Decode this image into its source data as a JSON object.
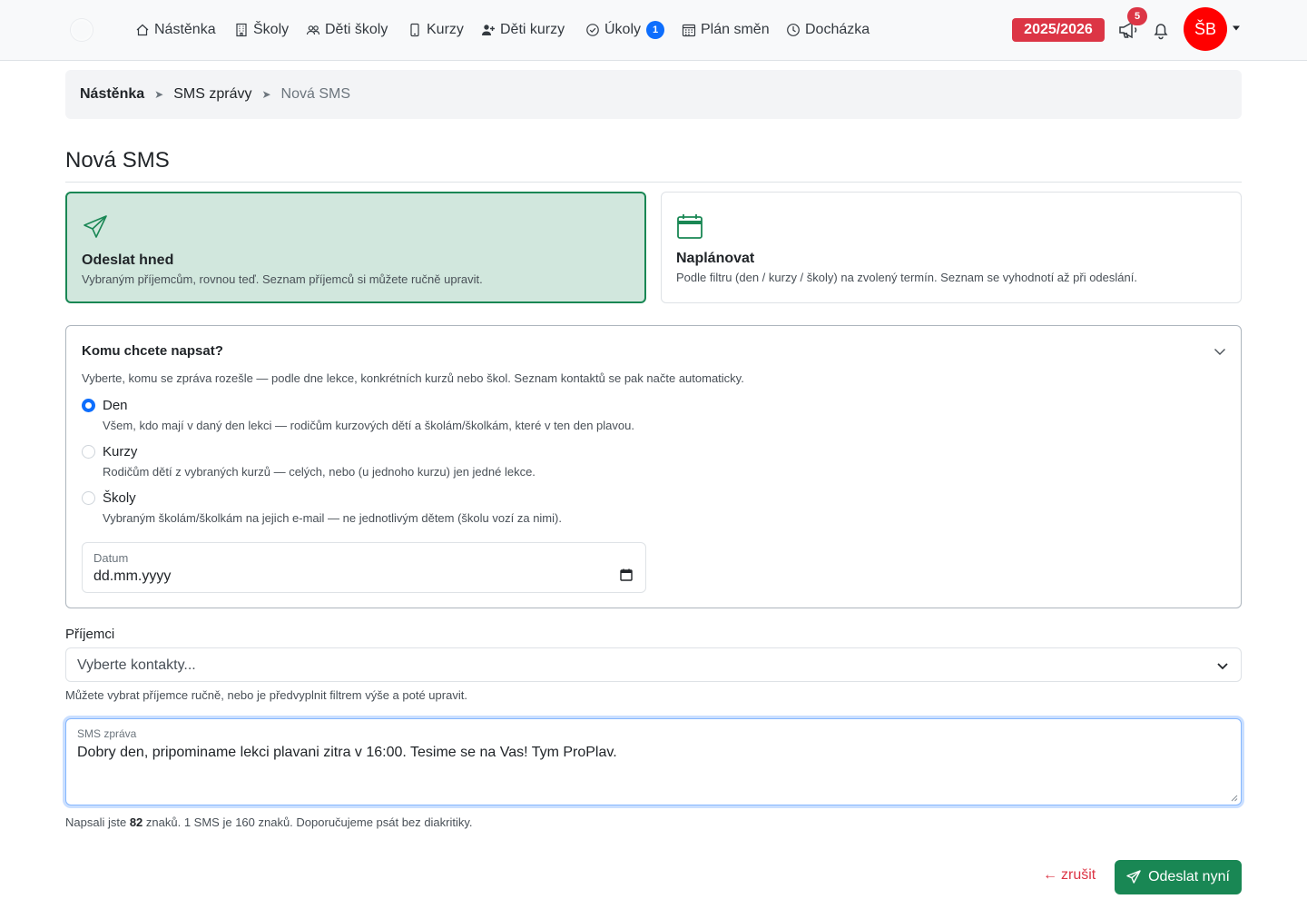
{
  "navbar": {
    "items": [
      {
        "label": "Nástěnka",
        "icon": "house-icon"
      },
      {
        "label": "Školy",
        "icon": "building-icon"
      },
      {
        "label": "Děti školy",
        "icon": "people-icon"
      },
      {
        "label": "Kurzy",
        "icon": "phone-icon"
      },
      {
        "label": "Děti kurzy",
        "icon": "person-add-icon"
      },
      {
        "label": "Úkoly",
        "icon": "check-circle-icon",
        "badge": "1"
      },
      {
        "label": "Plán směn",
        "icon": "calendar-grid-icon"
      },
      {
        "label": "Docházka",
        "icon": "clock-icon"
      }
    ],
    "season": "2025/2026",
    "announcements_count": "5",
    "avatar_initials": "ŠB"
  },
  "breadcrumb": [
    "Nástěnka",
    "SMS zprávy",
    "Nová SMS"
  ],
  "page_title": "Nová SMS",
  "modes": {
    "send_now": {
      "title": "Odeslat hned",
      "description": "Vybraným příjemcům, rovnou teď. Seznam příjemců si můžete ručně upravit.",
      "selected": true
    },
    "schedule": {
      "title": "Naplánovat",
      "description": "Podle filtru (den / kurzy / školy) na zvolený termín. Seznam se vyhodnotí až při odeslání.",
      "selected": false
    }
  },
  "filter": {
    "title": "Komu chcete napsat?",
    "description": "Vyberte, komu se zpráva rozešle — podle dne lekce, konkrétních kurzů nebo škol. Seznam kontaktů se pak načte automaticky.",
    "options": [
      {
        "label": "Den",
        "help": "Všem, kdo mají v daný den lekci — rodičům kurzových dětí a školám/školkám, které v ten den plavou.",
        "checked": true
      },
      {
        "label": "Kurzy",
        "help": "Rodičům dětí z vybraných kurzů — celých, nebo (u jednoho kurzu) jen jedné lekce.",
        "checked": false
      },
      {
        "label": "Školy",
        "help": "Vybraným školám/školkám na jejich e-mail — ne jednotlivým dětem (školu vozí za nimi).",
        "checked": false
      }
    ],
    "date_label": "Datum",
    "date_value": "dd.mm.yyyy"
  },
  "recipients": {
    "label": "Příjemci",
    "placeholder": "Vyberte kontakty...",
    "help": "Můžete vybrat příjemce ručně, nebo je předvyplnit filtrem výše a poté upravit."
  },
  "message": {
    "label": "SMS zpráva",
    "text": "Dobry den, pripominame lekci plavani zitra v 16:00. Tesime se na Vas! Tym ProPlav.",
    "counter_prefix": "Napsali jste",
    "char_count": "82",
    "counter_suffix": "znaků. 1 SMS je 160 znaků. Doporučujeme psát bez diakritiky."
  },
  "actions": {
    "cancel": "zrušit",
    "submit": "Odeslat nyní"
  },
  "colors": {
    "primary": "#0d6efd",
    "success": "#198754",
    "success_bg": "#d1e7dd",
    "danger": "#dc3545",
    "avatar": "#ff0000"
  }
}
